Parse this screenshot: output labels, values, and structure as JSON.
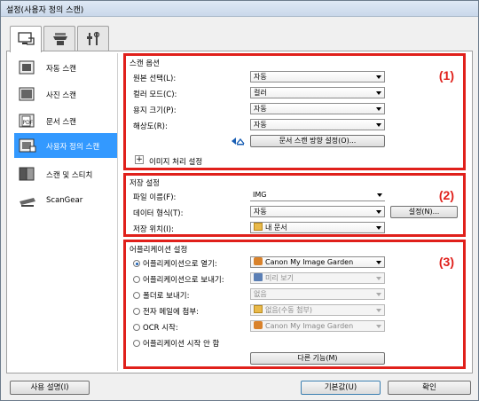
{
  "window": {
    "title": "설정(사용자 정의 스캔)"
  },
  "tabs": [
    {
      "name": "scan-from-computer",
      "icon": "computer-scan-icon",
      "active": true
    },
    {
      "name": "scan-from-panel",
      "icon": "scanner-icon",
      "active": false
    },
    {
      "name": "general-settings",
      "icon": "tools-icon",
      "active": false
    }
  ],
  "sidebar": {
    "items": [
      {
        "label": "자동 스캔",
        "icon": "auto-scan-icon"
      },
      {
        "label": "사진 스캔",
        "icon": "photo-scan-icon"
      },
      {
        "label": "문서 스캔",
        "icon": "document-scan-icon"
      },
      {
        "label": "사용자 정의 스캔",
        "icon": "custom-scan-icon",
        "selected": true
      },
      {
        "label": "스캔 및 스티치",
        "icon": "stitch-icon"
      },
      {
        "label": "ScanGear",
        "icon": "scangear-icon"
      }
    ]
  },
  "scan_options": {
    "title": "스캔 옵션",
    "number": "(1)",
    "source_label": "원본 선택(L):",
    "source_value": "자동",
    "color_mode_label": "컬러 모드(C):",
    "color_mode_value": "컬러",
    "paper_size_label": "용지 크기(P):",
    "paper_size_value": "자동",
    "resolution_label": "해상도(R):",
    "resolution_value": "자동",
    "orientation_button": "문서 스캔 방향 설정(O)...",
    "image_processing_label": "이미지 처리 설정",
    "expand_symbol": "+"
  },
  "save_settings": {
    "title": "저장 설정",
    "number": "(2)",
    "filename_label": "파일 이름(F):",
    "filename_value": "IMG",
    "data_format_label": "데이터 형식(T):",
    "data_format_value": "자동",
    "settings_button": "설정(N)...",
    "save_in_label": "저장 위치(I):",
    "save_in_value": "내 문서"
  },
  "app_settings": {
    "title": "어플리케이션 설정",
    "number": "(3)",
    "options": [
      {
        "label": "어플리케이션으로 열기:",
        "value": "Canon My Image Garden",
        "checked": true,
        "disabled": false,
        "icon": "garden-app-icon"
      },
      {
        "label": "어플리케이션으로 보내기:",
        "value": "미리 보기",
        "checked": false,
        "disabled": true,
        "icon": "preview-app-icon"
      },
      {
        "label": "폴더로 보내기:",
        "value": "없음",
        "checked": false,
        "disabled": true,
        "icon": ""
      },
      {
        "label": "전자 메일에 첨부:",
        "value": "없음(수동 첨부)",
        "checked": false,
        "disabled": true,
        "icon": "folder-icon"
      },
      {
        "label": "OCR 시작:",
        "value": "Canon My Image Garden",
        "checked": false,
        "disabled": true,
        "icon": "garden-app-icon"
      },
      {
        "label": "어플리케이션 시작 안 함",
        "value": "",
        "checked": false,
        "disabled": false,
        "icon": ""
      }
    ],
    "more_functions_button": "다른 기능(M)"
  },
  "footer": {
    "instructions_button": "사용 설명(I)",
    "defaults_button": "기본값(U)",
    "ok_button": "확인"
  },
  "colors": {
    "highlight": "#e0201b",
    "selection": "#3399ff"
  }
}
